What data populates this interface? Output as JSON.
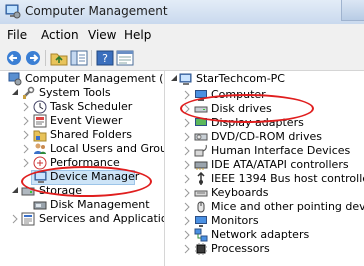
{
  "window": {
    "title": "Computer Management"
  },
  "menu": {
    "items": [
      "File",
      "Action",
      "View",
      "Help"
    ]
  },
  "toolbar": {
    "icons": [
      "back-arrow-icon",
      "forward-arrow-icon",
      "up-folder-icon",
      "show-hide-tree-icon",
      "help-icon",
      "properties-icon"
    ]
  },
  "left_tree": {
    "root": "Computer Management (Local",
    "system_tools": "System Tools",
    "task_scheduler": "Task Scheduler",
    "event_viewer": "Event Viewer",
    "shared_folders": "Shared Folders",
    "local_users": "Local Users and Groups",
    "performance": "Performance",
    "device_manager": "Device Manager",
    "storage": "Storage",
    "disk_management": "Disk Management",
    "services_apps": "Services and Applications"
  },
  "right_tree": {
    "root": "StarTechcom-PC",
    "items": [
      "Computer",
      "Disk drives",
      "Display adapters",
      "DVD/CD-ROM drives",
      "Human Interface Devices",
      "IDE ATA/ATAPI controllers",
      "IEEE 1394 Bus host controllers",
      "Keyboards",
      "Mice and other pointing devices",
      "Monitors",
      "Network adapters",
      "Processors"
    ]
  },
  "colors": {
    "highlight_ring": "#e01e1e",
    "selection": "#cde4f7"
  }
}
